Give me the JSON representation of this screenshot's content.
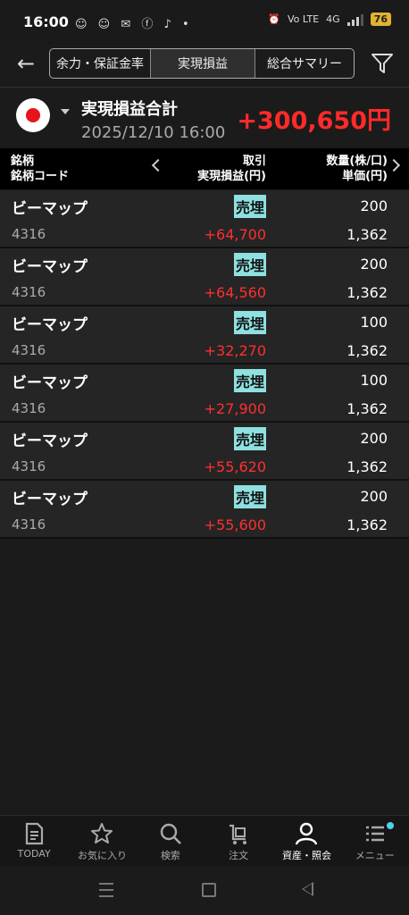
{
  "status_bar": {
    "time": "16:00",
    "volte": "Vo LTE",
    "network": "4G",
    "battery": "76"
  },
  "tabs": [
    {
      "label": "余力・保証金率",
      "active": false
    },
    {
      "label": "実現損益",
      "active": true
    },
    {
      "label": "総合サマリー",
      "active": false
    }
  ],
  "summary": {
    "label": "実現損益合計",
    "datetime": "2025/12/10  16:00",
    "value": "+300,650円"
  },
  "table_header": {
    "col1_line1": "銘柄",
    "col1_line2": "銘柄コード",
    "col2_line1": "取引",
    "col2_line2": "実現損益(円)",
    "col3_line1": "数量(株/口)",
    "col3_line2": "単価(円)"
  },
  "rows": [
    {
      "name": "ビーマップ",
      "code": "4316",
      "type": "売埋",
      "pl": "+64,700",
      "qty": "200",
      "price": "1,362"
    },
    {
      "name": "ビーマップ",
      "code": "4316",
      "type": "売埋",
      "pl": "+64,560",
      "qty": "200",
      "price": "1,362"
    },
    {
      "name": "ビーマップ",
      "code": "4316",
      "type": "売埋",
      "pl": "+32,270",
      "qty": "100",
      "price": "1,362"
    },
    {
      "name": "ビーマップ",
      "code": "4316",
      "type": "売埋",
      "pl": "+27,900",
      "qty": "100",
      "price": "1,362"
    },
    {
      "name": "ビーマップ",
      "code": "4316",
      "type": "売埋",
      "pl": "+55,620",
      "qty": "200",
      "price": "1,362"
    },
    {
      "name": "ビーマップ",
      "code": "4316",
      "type": "売埋",
      "pl": "+55,600",
      "qty": "200",
      "price": "1,362"
    }
  ],
  "bottom_nav": [
    {
      "label": "TODAY",
      "icon": "document-icon"
    },
    {
      "label": "お気に入り",
      "icon": "star-icon"
    },
    {
      "label": "検索",
      "icon": "search-icon"
    },
    {
      "label": "注文",
      "icon": "cart-icon"
    },
    {
      "label": "資産・照会",
      "icon": "person-icon"
    },
    {
      "label": "メニュー",
      "icon": "menu-icon"
    }
  ],
  "colors": {
    "profit": "#ff2a2a",
    "tag_bg": "#8fe0e0",
    "accent_dot": "#4fd0e8"
  }
}
